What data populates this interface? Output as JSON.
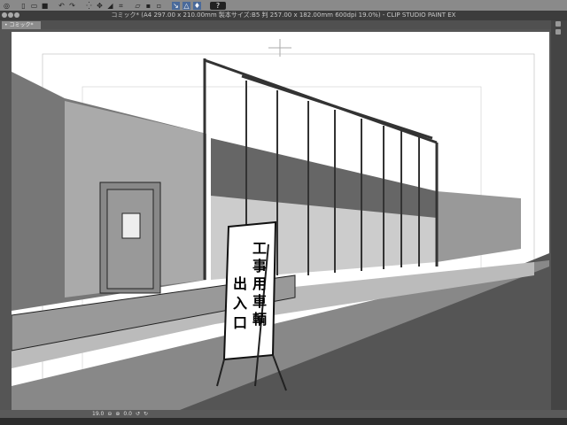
{
  "toolbar": {
    "icons": [
      "clip-studio-icon",
      "new-icon",
      "open-icon",
      "save-icon",
      "undo-icon",
      "redo-icon",
      "selection-icon",
      "transform-icon",
      "fill-icon",
      "crop-icon",
      "ruler-icon",
      "snap-icon",
      "grid-icon",
      "pen-icon",
      "perspective-icon",
      "stabilizer-icon"
    ],
    "help_label": "?"
  },
  "titlebar": {
    "title": "コミック* (A4 297.00 x 210.00mm 製本サイズ:B5 判 257.00 x 182.00mm 600dpi 19.0%)  - CLIP STUDIO PAINT EX"
  },
  "tab": {
    "label": "コミック*"
  },
  "statusbar": {
    "zoom": "19.0",
    "rotation": "0.0"
  },
  "illustration": {
    "sign_text": [
      "工",
      "事",
      "用",
      "車",
      "輌",
      "出",
      "入",
      "口"
    ]
  }
}
